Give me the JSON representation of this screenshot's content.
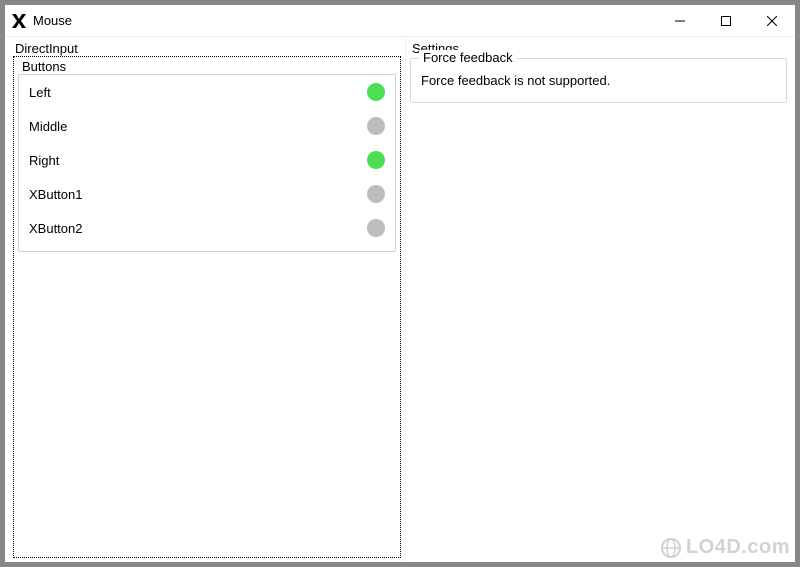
{
  "window": {
    "title": "Mouse"
  },
  "left": {
    "section_label": "DirectInput",
    "buttons_label": "Buttons",
    "buttons": [
      {
        "label": "Left",
        "active": true
      },
      {
        "label": "Middle",
        "active": false
      },
      {
        "label": "Right",
        "active": true
      },
      {
        "label": "XButton1",
        "active": false
      },
      {
        "label": "XButton2",
        "active": false
      }
    ]
  },
  "right": {
    "section_label": "Settings",
    "ff_legend": "Force feedback",
    "ff_message": "Force feedback is not supported."
  },
  "watermark": {
    "text": "LO4D.com"
  },
  "colors": {
    "indicator_on": "#4be054",
    "indicator_off": "#bdbdbd"
  }
}
